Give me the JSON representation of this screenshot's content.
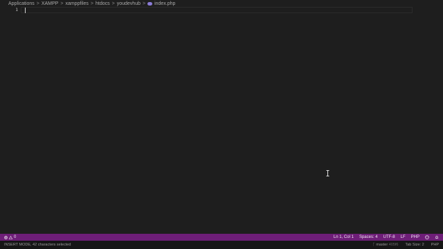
{
  "breadcrumb": {
    "items": [
      "Applications",
      "XAMPP",
      "xamppfiles",
      "htdocs",
      "youdevhub",
      "index.php"
    ],
    "separator": ">",
    "file_icon": "php-file-icon"
  },
  "editor": {
    "line_numbers": [
      "1"
    ],
    "content": ""
  },
  "statusbar": {
    "errors": "0",
    "ln_col": "Ln 1, Col 1",
    "spaces": "Spaces: 4",
    "encoding": "UTF-8",
    "eol": "LF",
    "language": "PHP",
    "background_color": "#6e1e78"
  },
  "bottombar": {
    "mode": "INSERT MODE, 42 characters selected",
    "branch": "master",
    "branch_hash": "405f6",
    "tab_size": "Tab Size: 2",
    "language": "PHP"
  }
}
